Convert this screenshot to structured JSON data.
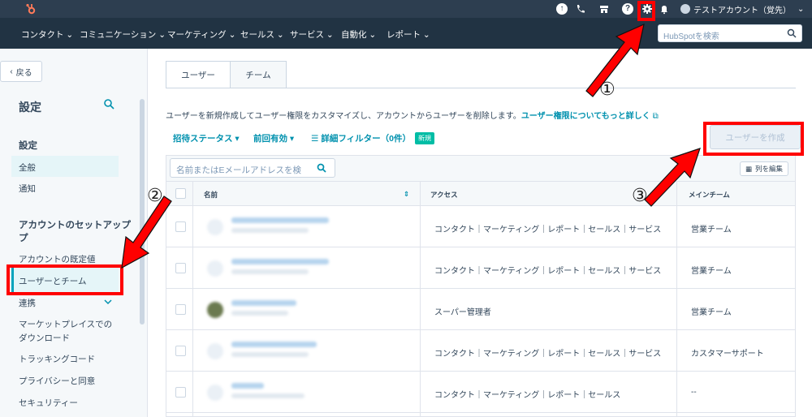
{
  "topbar": {
    "account_name": "テストアカウント（覚先）"
  },
  "nav": {
    "items": [
      "コンタクト ⌄",
      "コミュニケーション ⌄",
      "マーケティング ⌄",
      "セールス ⌄",
      "サービス ⌄",
      "自動化 ⌄",
      "レポート ⌄"
    ],
    "search_placeholder": "HubSpotを検索"
  },
  "sidebar": {
    "back_label": "戻る",
    "title": "設定",
    "section1": "設定",
    "general": "全般",
    "notifications": "通知",
    "section2": "アカウントのセットアップ",
    "section2_line2": "プ",
    "account_defaults": "アカウントの既定値",
    "users_and_teams": "ユーザーとチーム",
    "integrations": "連携",
    "marketplace_line1": "マーケットプレイスでの",
    "marketplace_line2": "ダウンロード",
    "tracking_code": "トラッキングコード",
    "privacy": "プライバシーと同意",
    "security": "セキュリティー"
  },
  "main": {
    "tab_users": "ユーザー",
    "tab_teams": "チーム",
    "description": "ユーザーを新規作成してユーザー権限をカスタマイズし、アカウントからユーザーを削除します。",
    "description_link": "ユーザー権限についてもっと詳しく",
    "filter_invite": "招待ステータス ▾",
    "filter_last_active": "前回有効 ▾",
    "filter_advanced": "詳細フィルター（0件）",
    "badge_new": "新規",
    "create_user": "ユーザーを作成",
    "table_search_placeholder": "名前またはEメールアドレスを検",
    "edit_columns": "列を編集",
    "col_name": "名前",
    "col_access": "アクセス",
    "col_team": "メインチーム"
  },
  "rows": [
    {
      "access": "コンタクト｜マーケティング｜レポート｜セールス｜サービス",
      "team": "営業チーム"
    },
    {
      "access": "コンタクト｜マーケティング｜レポート｜セールス｜サービス",
      "team": "営業チーム"
    },
    {
      "access": "スーパー管理者",
      "team": "営業チーム"
    },
    {
      "access": "コンタクト｜マーケティング｜レポート｜セールス｜サービス",
      "team": "カスタマーサポート"
    },
    {
      "access": "コンタクト｜マーケティング｜レポート｜セールス",
      "team": "--"
    }
  ],
  "annotations": {
    "n1": "①",
    "n2": "②",
    "n3": "③"
  },
  "colors": {
    "topbar": "#2d3e50",
    "nav": "#213343",
    "accent": "#0091ae",
    "annotation": "#ff0000"
  }
}
